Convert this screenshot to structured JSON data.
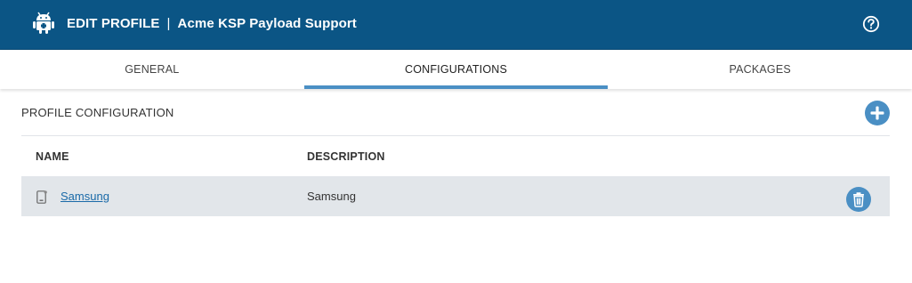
{
  "header": {
    "title": "EDIT PROFILE",
    "separator": "|",
    "subtitle": "Acme KSP Payload Support",
    "logo_icon": "android-icon",
    "help_icon": "help-circle-icon",
    "background": "#0b5585"
  },
  "tabs": [
    {
      "label": "GENERAL",
      "active": false
    },
    {
      "label": "CONFIGURATIONS",
      "active": true
    },
    {
      "label": "PACKAGES",
      "active": false
    }
  ],
  "section": {
    "title": "PROFILE CONFIGURATION",
    "add_icon": "plus-circle-icon"
  },
  "table": {
    "columns": [
      "NAME",
      "DESCRIPTION"
    ],
    "rows": [
      {
        "name": "Samsung",
        "description": "Samsung",
        "icon": "device-icon",
        "delete_icon": "trash-icon"
      }
    ]
  },
  "colors": {
    "accent": "#4a8fc4",
    "link": "#1a6aa8",
    "row_bg": "#e2e6ea"
  }
}
